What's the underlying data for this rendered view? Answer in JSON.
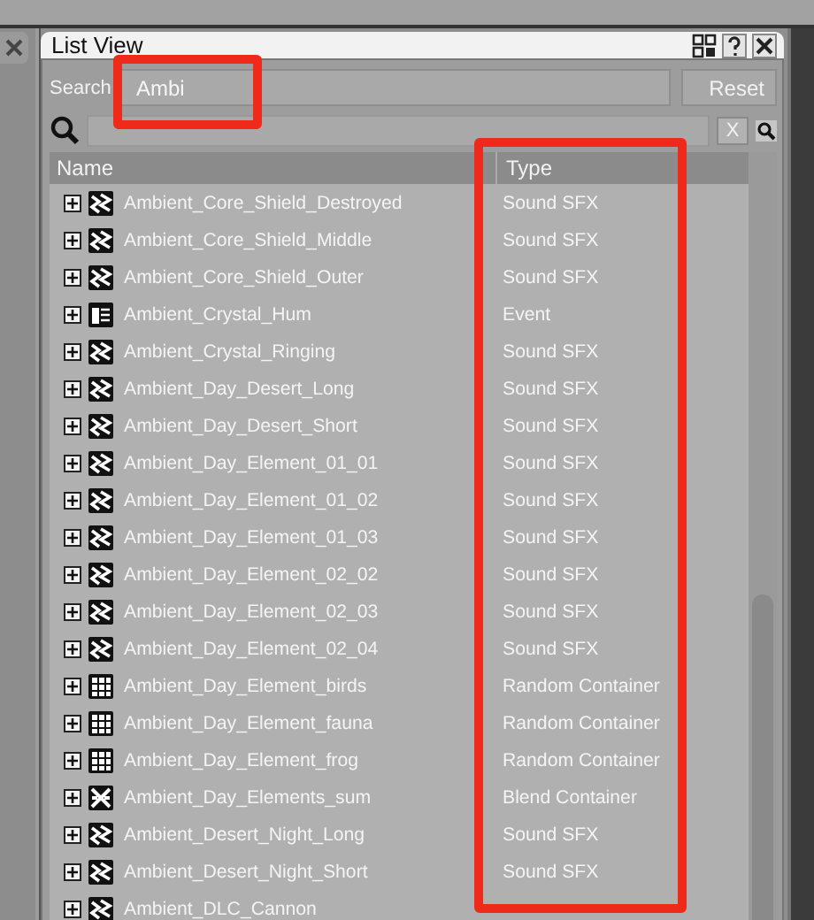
{
  "window": {
    "title": "List View"
  },
  "search": {
    "label": "Search",
    "value": "Ambi",
    "highlight": true
  },
  "reset_button": "Reset",
  "filter": {
    "clear": "X"
  },
  "table": {
    "columns": [
      {
        "label": "Name",
        "highlight": false
      },
      {
        "label": "Type",
        "highlight": true
      }
    ],
    "rows": [
      {
        "name": "Ambient_Core_Shield_Destroyed",
        "type": "Sound SFX",
        "kind": "sfx"
      },
      {
        "name": "Ambient_Core_Shield_Middle",
        "type": "Sound SFX",
        "kind": "sfx"
      },
      {
        "name": "Ambient_Core_Shield_Outer",
        "type": "Sound SFX",
        "kind": "sfx"
      },
      {
        "name": "Ambient_Crystal_Hum",
        "type": "Event",
        "kind": "event"
      },
      {
        "name": "Ambient_Crystal_Ringing",
        "type": "Sound SFX",
        "kind": "sfx"
      },
      {
        "name": "Ambient_Day_Desert_Long",
        "type": "Sound SFX",
        "kind": "sfx"
      },
      {
        "name": "Ambient_Day_Desert_Short",
        "type": "Sound SFX",
        "kind": "sfx"
      },
      {
        "name": "Ambient_Day_Element_01_01",
        "type": "Sound SFX",
        "kind": "sfx"
      },
      {
        "name": "Ambient_Day_Element_01_02",
        "type": "Sound SFX",
        "kind": "sfx"
      },
      {
        "name": "Ambient_Day_Element_01_03",
        "type": "Sound SFX",
        "kind": "sfx"
      },
      {
        "name": "Ambient_Day_Element_02_02",
        "type": "Sound SFX",
        "kind": "sfx"
      },
      {
        "name": "Ambient_Day_Element_02_03",
        "type": "Sound SFX",
        "kind": "sfx"
      },
      {
        "name": "Ambient_Day_Element_02_04",
        "type": "Sound SFX",
        "kind": "sfx"
      },
      {
        "name": "Ambient_Day_Element_birds",
        "type": "Random Container",
        "kind": "random"
      },
      {
        "name": "Ambient_Day_Element_fauna",
        "type": "Random Container",
        "kind": "random"
      },
      {
        "name": "Ambient_Day_Element_frog",
        "type": "Random Container",
        "kind": "random"
      },
      {
        "name": "Ambient_Day_Elements_sum",
        "type": "Blend Container",
        "kind": "blend"
      },
      {
        "name": "Ambient_Desert_Night_Long",
        "type": "Sound SFX",
        "kind": "sfx"
      },
      {
        "name": "Ambient_Desert_Night_Short",
        "type": "Sound SFX",
        "kind": "sfx"
      },
      {
        "name": "Ambient_DLC_Cannon",
        "kind": "sfx"
      }
    ]
  }
}
